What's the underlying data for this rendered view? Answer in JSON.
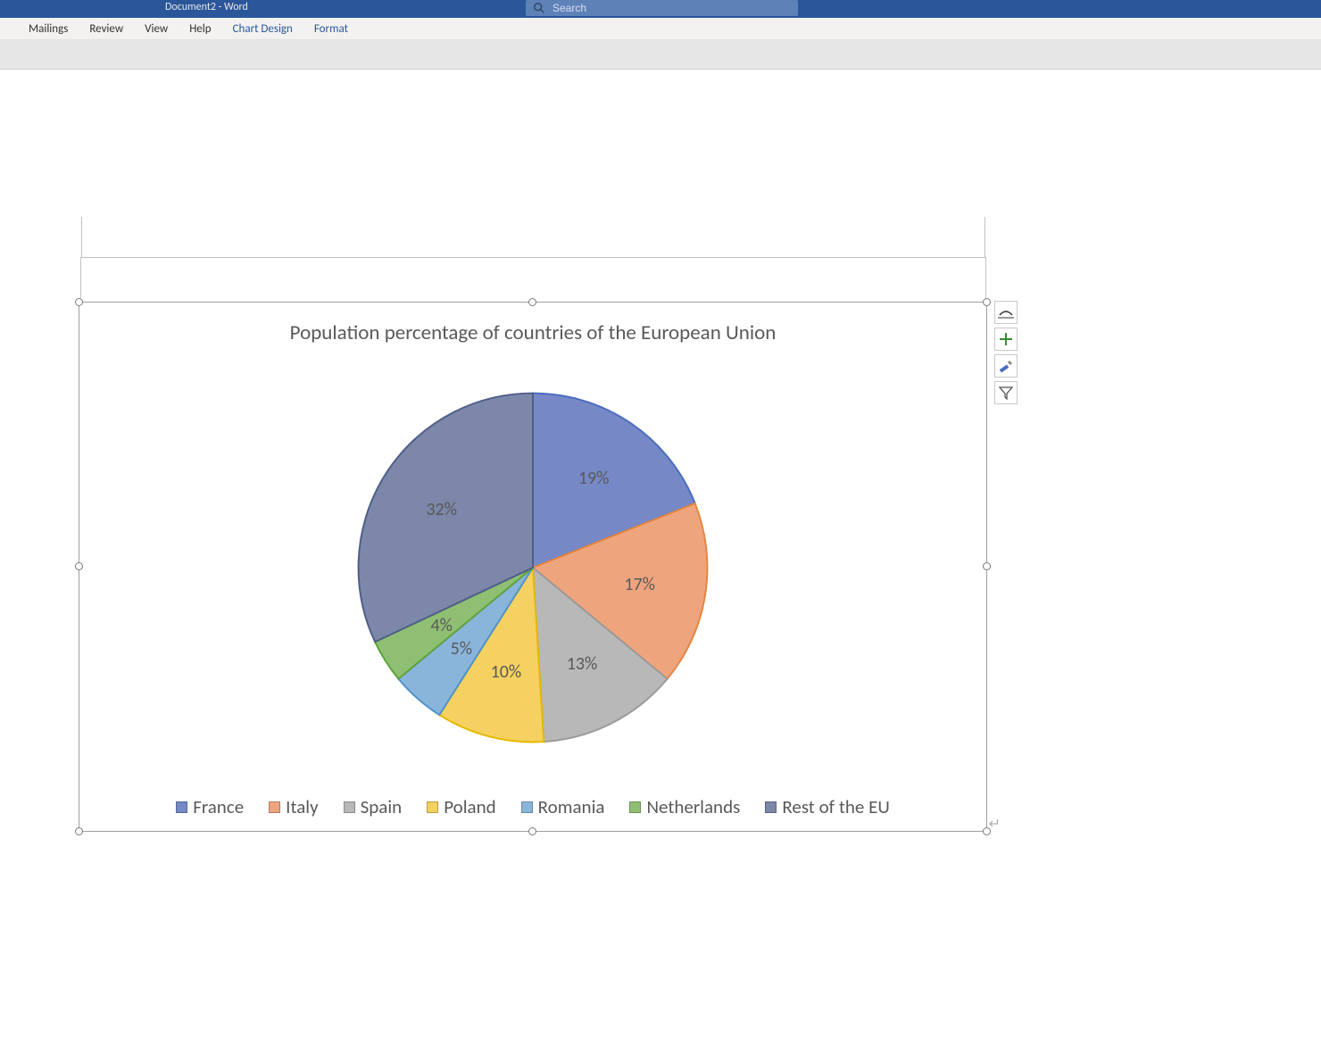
{
  "window": {
    "title": "Document2  -  Word"
  },
  "search": {
    "placeholder": "Search"
  },
  "ribbon": {
    "tabs": [
      "Mailings",
      "Review",
      "View",
      "Help",
      "Chart Design",
      "Format"
    ]
  },
  "chart_data": {
    "type": "pie",
    "title": "Population percentage of countries of the European Union",
    "series": [
      {
        "name": "France",
        "value": 19,
        "label": "19%",
        "color": "#7689c6",
        "stroke": "#4a6bbf"
      },
      {
        "name": "Italy",
        "value": 17,
        "label": "17%",
        "color": "#eea57e",
        "stroke": "#e6843e"
      },
      {
        "name": "Spain",
        "value": 13,
        "label": "13%",
        "color": "#b8b8b8",
        "stroke": "#9a9a9a"
      },
      {
        "name": "Poland",
        "value": 10,
        "label": "10%",
        "color": "#f4d161",
        "stroke": "#e6b800"
      },
      {
        "name": "Romania",
        "value": 5,
        "label": "5%",
        "color": "#8ab5db",
        "stroke": "#4f91cc"
      },
      {
        "name": "Netherlands",
        "value": 4,
        "label": "4%",
        "color": "#8fbf73",
        "stroke": "#5ea33b"
      },
      {
        "name": "Rest of the EU",
        "value": 32,
        "label": "32%",
        "color": "#7c87a9",
        "stroke": "#4f5e88"
      }
    ]
  },
  "floatbtns": {
    "layout": "layout-options-button",
    "elements": "chart-elements-button",
    "styles": "chart-styles-button",
    "filters": "chart-filters-button"
  }
}
